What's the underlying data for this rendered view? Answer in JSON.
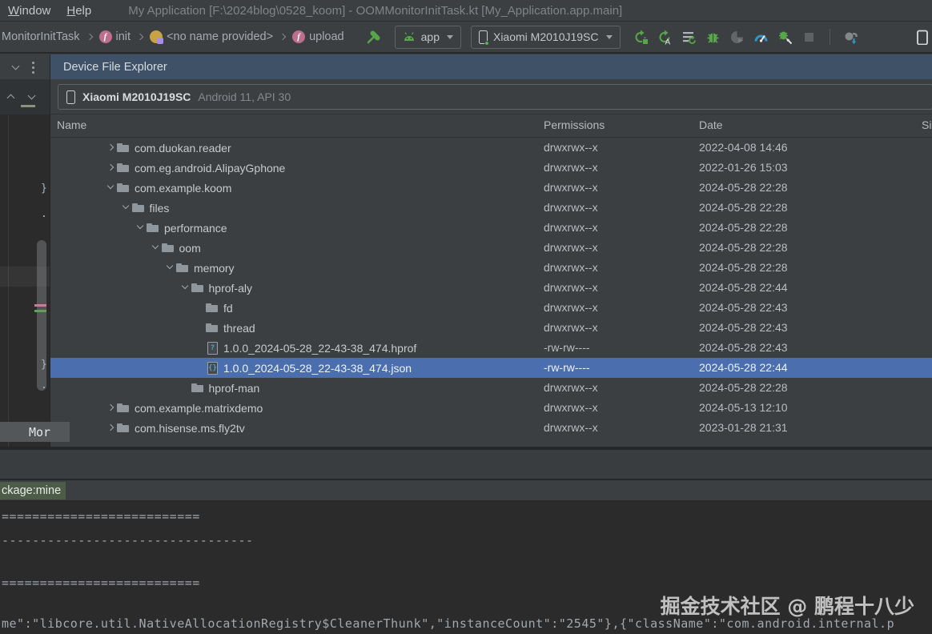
{
  "menu_bar": {
    "items": [
      "Window",
      "Help"
    ],
    "window_title": "My Application [F:\\2024blog\\0528_koom] - OOMMonitorInitTask.kt [My_Application.app.main]"
  },
  "navbar": {
    "breadcrumbs": [
      {
        "label": "MonitorInitTask",
        "icon": "none"
      },
      {
        "label": "init",
        "icon": "function"
      },
      {
        "label": "<no name provided>",
        "icon": "anonymous-class"
      },
      {
        "label": "upload",
        "icon": "function"
      }
    ],
    "run_config_label": "app",
    "device_label": "Xiaomi M2010J19SC",
    "action_icons": [
      "build-hammer",
      "apply-changes",
      "apply-code-changes",
      "run-with-coverage",
      "debug",
      "profile",
      "profiler",
      "attach-debugger",
      "stop",
      "gradle-sync",
      "device-partial"
    ]
  },
  "device_explorer": {
    "title": "Device File Explorer",
    "device_name": "Xiaomi M2010J19SC",
    "device_info": "Android 11, API 30",
    "columns": {
      "name": "Name",
      "permissions": "Permissions",
      "date": "Date",
      "size": "Si"
    },
    "rows": [
      {
        "name": "com.duokan.reader",
        "level": 0,
        "type": "folder",
        "expanded": false,
        "permissions": "drwxrwx--x",
        "date": "2022-04-08 14:46"
      },
      {
        "name": "com.eg.android.AlipayGphone",
        "level": 0,
        "type": "folder",
        "expanded": false,
        "permissions": "drwxrwx--x",
        "date": "2022-01-26 15:03"
      },
      {
        "name": "com.example.koom",
        "level": 0,
        "type": "folder",
        "expanded": true,
        "permissions": "drwxrwx--x",
        "date": "2024-05-28 22:28"
      },
      {
        "name": "files",
        "level": 1,
        "type": "folder",
        "expanded": true,
        "permissions": "drwxrwx--x",
        "date": "2024-05-28 22:28"
      },
      {
        "name": "performance",
        "level": 2,
        "type": "folder",
        "expanded": true,
        "permissions": "drwxrwx--x",
        "date": "2024-05-28 22:28"
      },
      {
        "name": "oom",
        "level": 3,
        "type": "folder",
        "expanded": true,
        "permissions": "drwxrwx--x",
        "date": "2024-05-28 22:28"
      },
      {
        "name": "memory",
        "level": 4,
        "type": "folder",
        "expanded": true,
        "permissions": "drwxrwx--x",
        "date": "2024-05-28 22:28"
      },
      {
        "name": "hprof-aly",
        "level": 5,
        "type": "folder",
        "expanded": true,
        "permissions": "drwxrwx--x",
        "date": "2024-05-28 22:44"
      },
      {
        "name": "fd",
        "level": 6,
        "type": "folder",
        "permissions": "drwxrwx--x",
        "date": "2024-05-28 22:43"
      },
      {
        "name": "thread",
        "level": 6,
        "type": "folder",
        "permissions": "drwxrwx--x",
        "date": "2024-05-28 22:43"
      },
      {
        "name": "1.0.0_2024-05-28_22-43-38_474.hprof",
        "level": 6,
        "type": "file-hprof",
        "permissions": "-rw-rw----",
        "date": "2024-05-28 22:43"
      },
      {
        "name": "1.0.0_2024-05-28_22-43-38_474.json",
        "level": 6,
        "type": "file-json",
        "permissions": "-rw-rw----",
        "date": "2024-05-28 22:44",
        "selected": true
      },
      {
        "name": "hprof-man",
        "level": 5,
        "type": "folder",
        "permissions": "drwxrwx--x",
        "date": "2024-05-28 22:28"
      },
      {
        "name": "com.example.matrixdemo",
        "level": 0,
        "type": "folder",
        "expanded": false,
        "permissions": "drwxrwx--x",
        "date": "2024-05-13 12:10"
      },
      {
        "name": "com.hisense.ms.fly2tv",
        "level": 0,
        "type": "folder",
        "expanded": false,
        "permissions": "drwxrwx--x",
        "date": "2023-01-28 21:31"
      }
    ]
  },
  "editor_strip": {
    "fragments": [
      "}",
      ".",
      "}",
      "."
    ],
    "more_label": "Mor"
  },
  "logcat": {
    "filter_text": "ckage:mine"
  },
  "console": {
    "line1": "==========================",
    "line2": "---------------------------------",
    "line3": "==========================",
    "json_line": "me\":\"libcore.util.NativeAllocationRegistry$CleanerThunk\",\"instanceCount\":\"2545\"},{\"className\":\"com.android.internal.p"
  },
  "watermark": "掘金技术社区 @ 鹏程十八少",
  "colors": {
    "selection": "#4b6eaf",
    "panel_header": "#3e5166",
    "accent_green": "#5ba35a",
    "accent_blue": "#3592c4"
  }
}
